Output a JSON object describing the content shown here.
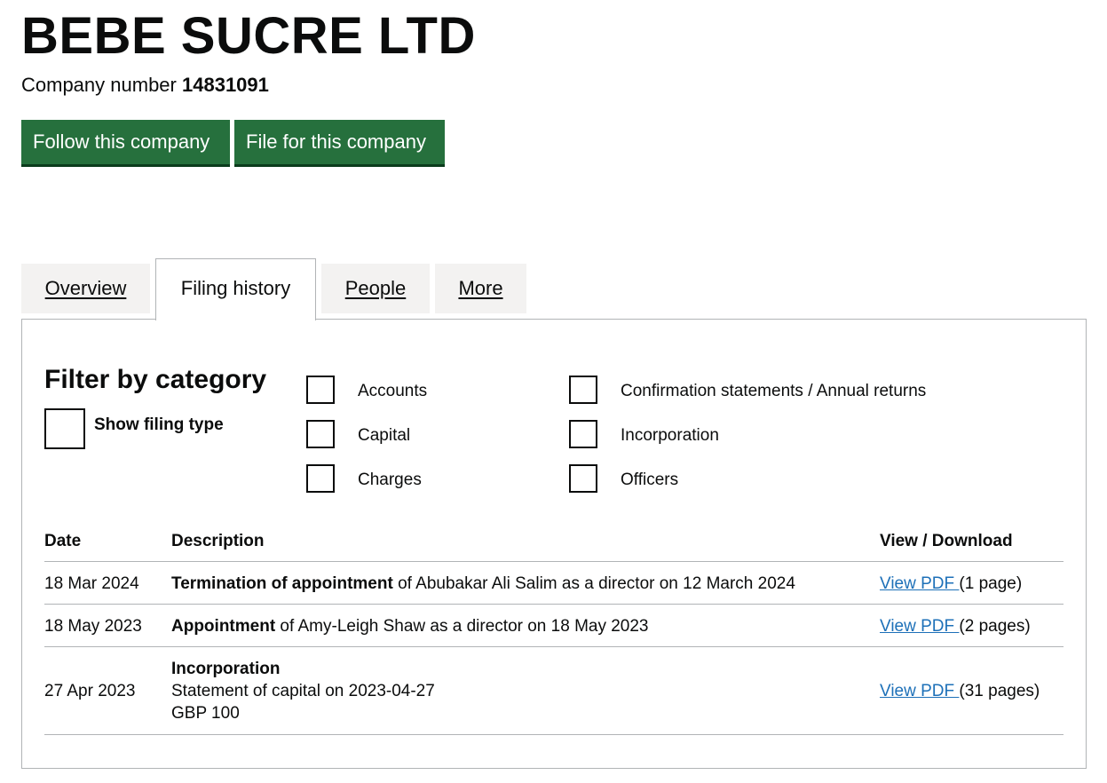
{
  "company": {
    "name": "BEBE SUCRE LTD",
    "number_label": "Company number",
    "number": "14831091"
  },
  "actions": {
    "follow": "Follow this company",
    "file": "File for this company"
  },
  "tabs": [
    {
      "label": "Overview",
      "active": false
    },
    {
      "label": "Filing history",
      "active": true
    },
    {
      "label": "People",
      "active": false
    },
    {
      "label": "More",
      "active": false
    }
  ],
  "filter": {
    "title": "Filter by category",
    "show_filing_type": "Show filing type",
    "categories": [
      "Accounts",
      "Capital",
      "Charges",
      "Confirmation statements / Annual returns",
      "Incorporation",
      "Officers"
    ]
  },
  "table": {
    "headers": {
      "date": "Date",
      "description": "Description",
      "view": "View / Download"
    },
    "rows": [
      {
        "date": "18 Mar 2024",
        "type": "Termination of appointment",
        "detail": " of Abubakar Ali Salim as a director on 12 March 2024",
        "link": "View PDF ",
        "pages": "(1 page)"
      },
      {
        "date": "18 May 2023",
        "type": "Appointment",
        "detail": " of Amy-Leigh Shaw as a director on 18 May 2023",
        "link": "View PDF ",
        "pages": "(2 pages)"
      },
      {
        "date": "27 Apr 2023",
        "type": "Incorporation",
        "detail_line1": "Statement of capital on 2023-04-27",
        "detail_line2": "GBP 100",
        "link": "View PDF ",
        "pages": "(31 pages)"
      }
    ]
  }
}
